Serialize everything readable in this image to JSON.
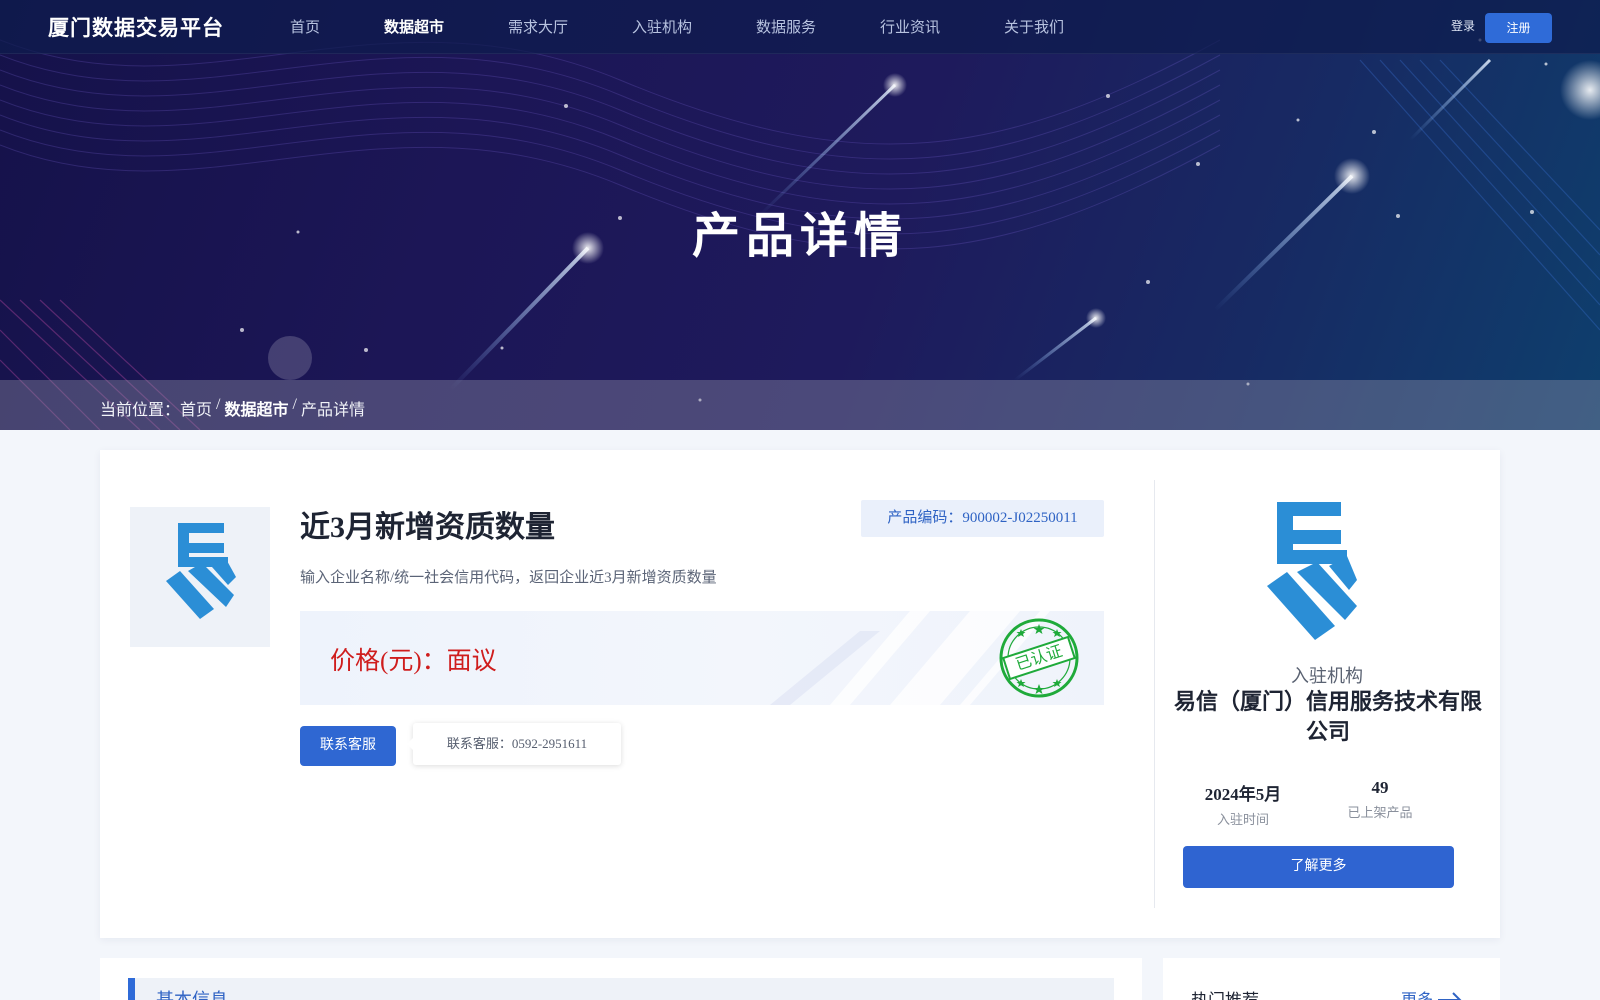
{
  "header": {
    "logo": "厦门数据交易平台",
    "nav": [
      {
        "label": "首页",
        "active": false
      },
      {
        "label": "数据超市",
        "active": true
      },
      {
        "label": "需求大厅",
        "active": false
      },
      {
        "label": "入驻机构",
        "active": false
      },
      {
        "label": "数据服务",
        "active": false
      },
      {
        "label": "行业资讯",
        "active": false
      },
      {
        "label": "关于我们",
        "active": false
      }
    ],
    "login": "登录",
    "register": "注册"
  },
  "hero": {
    "title": "产品详情"
  },
  "breadcrumb": {
    "prefix": "当前位置：首页",
    "sep1": " / ",
    "current_section": "数据超市",
    "sep2": " / ",
    "page": "产品详情"
  },
  "product": {
    "logo_icon": "yixin-logo-icon",
    "title": "近3月新增资质数量",
    "code_label": "产品编码：900002-J02250011",
    "description": "输入企业名称/统一社会信用代码，返回企业近3月新增资质数量",
    "price_label": "价格(元)：面议",
    "stamp_text": "已认证",
    "contact_button": "联系客服",
    "contact_tip": "联系客服：0592-2951611"
  },
  "org": {
    "label": "入驻机构",
    "name": "易信（厦门）信用服务技术有限公司",
    "join_time_value": "2024年5月",
    "join_time_label": "入驻时间",
    "products_value": "49",
    "products_label": "已上架产品",
    "more_button": "了解更多"
  },
  "basic_info": {
    "title": "基本信息"
  },
  "hot": {
    "title": "热门推荐",
    "more": "更多"
  },
  "colors": {
    "accent": "#2f6bd8",
    "price_red": "#cf1d1d",
    "stamp_green": "#1faa3a",
    "logo_blue": "#2b8ed6"
  }
}
